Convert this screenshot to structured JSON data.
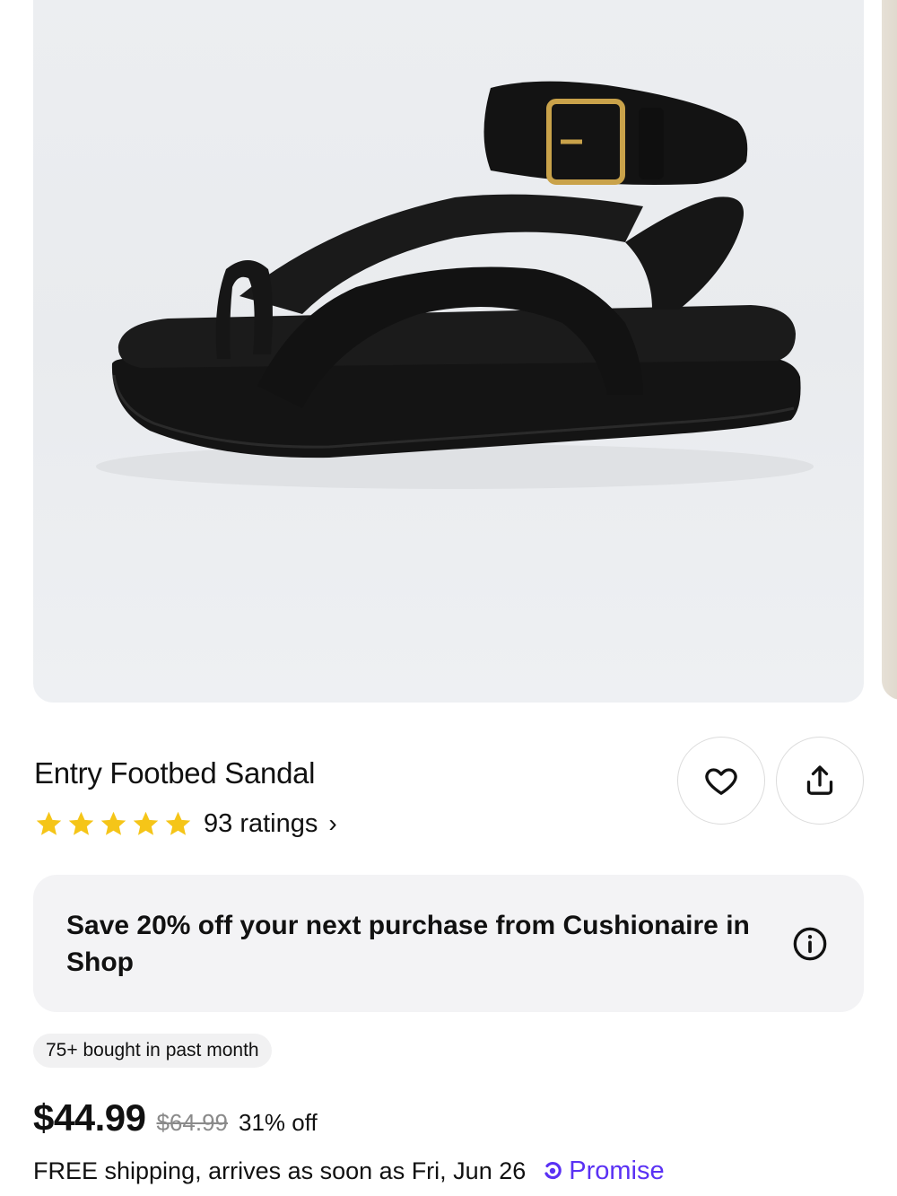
{
  "product": {
    "title": "Entry Footbed Sandal",
    "rating": 5,
    "ratings_text": "93 ratings",
    "ratings_chevron": "›",
    "image_alt": "black sandal product image"
  },
  "actions": {
    "favorite_icon": "heart-icon",
    "share_icon": "share-icon"
  },
  "promo": {
    "text": "Save 20% off your next purchase from Cushionaire in Shop",
    "info_icon": "info-icon"
  },
  "badge": {
    "text": "75+ bought in past month"
  },
  "pricing": {
    "price": "$44.99",
    "original_price": "$64.99",
    "discount": "31% off"
  },
  "shipping": {
    "text": "FREE shipping, arrives as soon as Fri, Jun 26",
    "promise_label": "Promise"
  },
  "colors": {
    "star": "#f5c518",
    "promise": "#5a31f4",
    "promo_bg": "#f3f3f5"
  }
}
